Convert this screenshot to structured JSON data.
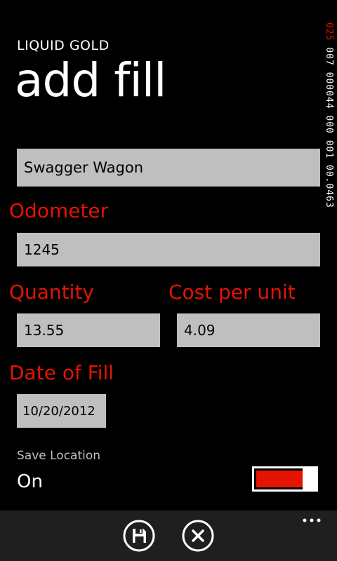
{
  "header": {
    "app_title": "LIQUID GOLD",
    "page_title": "add fill"
  },
  "form": {
    "vehicle_name": "Swagger Wagon",
    "odometer_label": "Odometer",
    "odometer_value": "1245",
    "quantity_label": "Quantity",
    "quantity_value": "13.55",
    "cost_label": "Cost per unit",
    "cost_value": "4.09",
    "date_label": "Date of Fill",
    "date_value": "10/20/2012"
  },
  "save_location": {
    "caption": "Save Location",
    "state": "On",
    "enabled": true
  },
  "debug_counter": {
    "accent_text": "025 ",
    "text": "007 000044 000 001 00.0463"
  },
  "app_bar": {
    "buttons": [
      {
        "icon": "save-icon"
      },
      {
        "icon": "close-icon"
      }
    ],
    "more_icon": "ellipsis-icon"
  },
  "colors": {
    "accent": "#e51400",
    "field_background": "#bfbfbf",
    "app_bar_background": "#1f1f1f",
    "background": "#000000"
  }
}
